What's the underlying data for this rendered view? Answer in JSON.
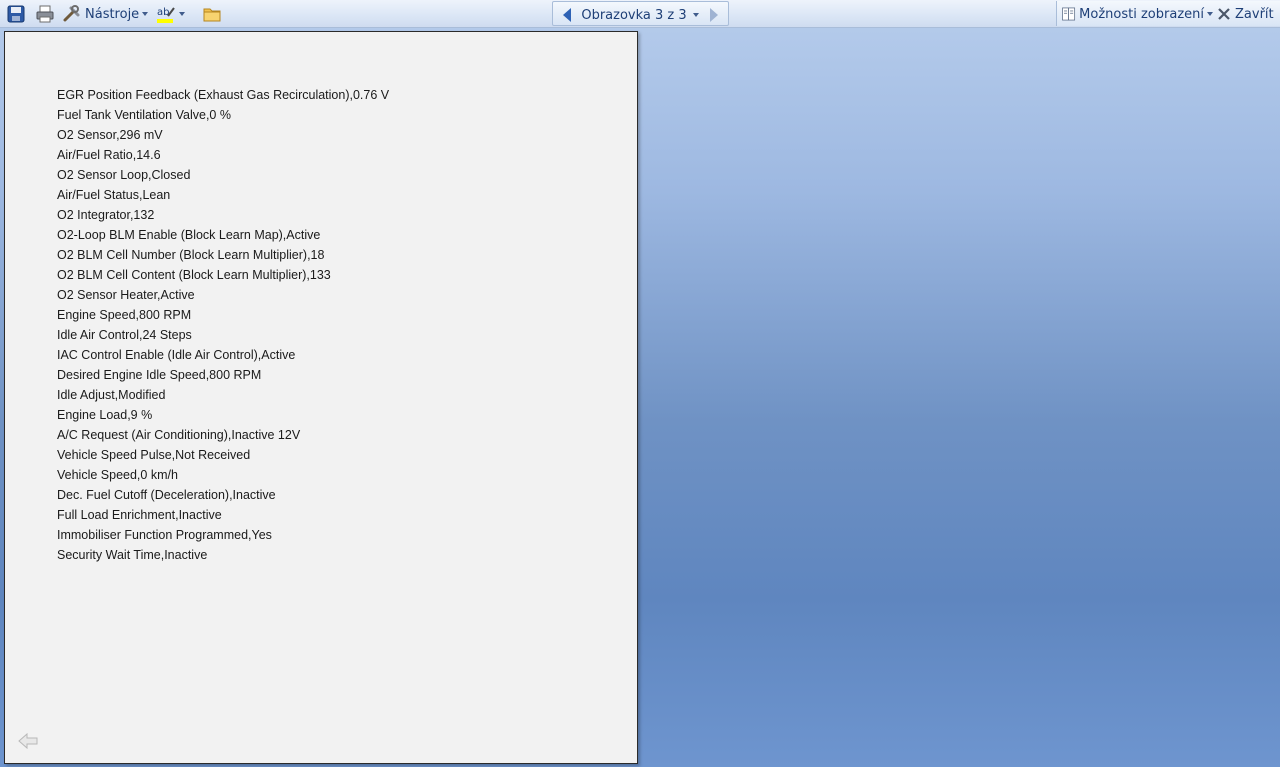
{
  "toolbar": {
    "save_icon": "save-icon",
    "print_icon": "print-icon",
    "tools_label": "Nástroje",
    "highlight_icon": "text-highlight-icon",
    "folder_icon": "folder-icon",
    "nav": {
      "prev_icon": "prev-screen-icon",
      "screen_label": "Obrazovka 3 z 3",
      "next_icon": "next-screen-icon"
    },
    "view_options_label": "Možnosti zobrazení",
    "close_label": "Zavřít"
  },
  "document": {
    "lines": [
      "EGR Position Feedback (Exhaust Gas Recirculation),0.76 V",
      "Fuel Tank Ventilation Valve,0 %",
      "O2 Sensor,296 mV",
      "Air/Fuel Ratio,14.6",
      "O2 Sensor Loop,Closed",
      "Air/Fuel Status,Lean",
      "O2 Integrator,132",
      "O2-Loop BLM Enable (Block Learn Map),Active",
      "O2 BLM Cell Number (Block Learn Multiplier),18",
      "O2 BLM Cell Content (Block Learn Multiplier),133",
      "O2 Sensor Heater,Active",
      "Engine Speed,800 RPM",
      "Idle Air Control,24 Steps",
      "IAC Control Enable (Idle Air Control),Active",
      "Desired Engine Idle Speed,800 RPM",
      "Idle Adjust,Modified",
      "Engine Load,9 %",
      "A/C Request (Air Conditioning),Inactive 12V",
      "Vehicle Speed Pulse,Not Received",
      "Vehicle Speed,0 km/h",
      "Dec. Fuel Cutoff (Deceleration),Inactive",
      "Full Load Enrichment,Inactive",
      "Immobiliser Function Programmed,Yes",
      "Security Wait Time,Inactive"
    ],
    "back_icon": "back-arrow-icon"
  }
}
